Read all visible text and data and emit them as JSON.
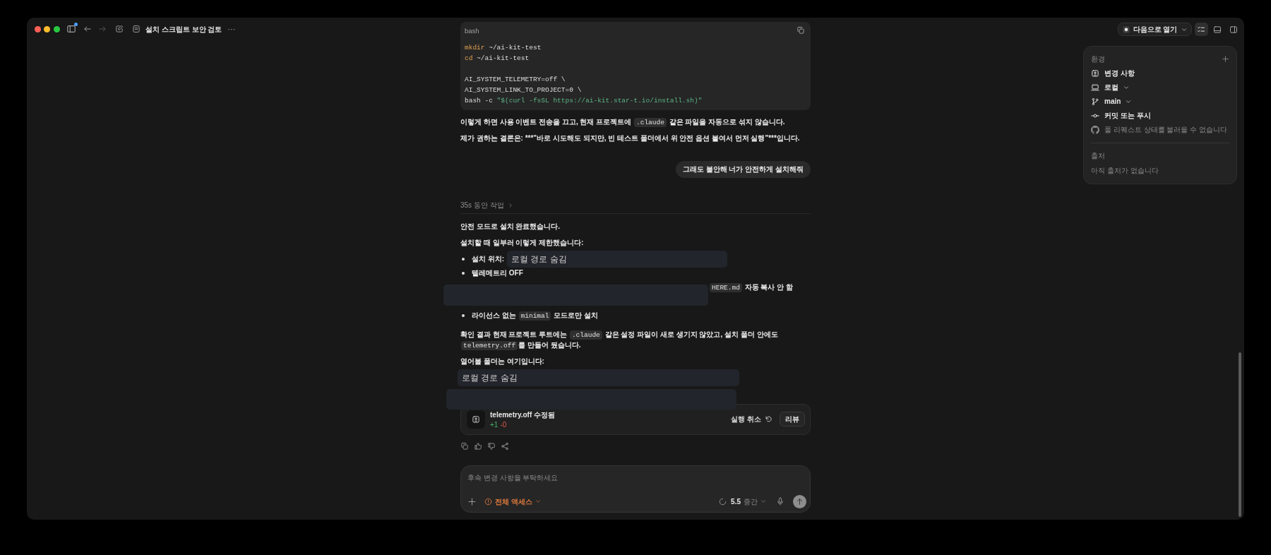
{
  "titlebar": {
    "sidebar_unread": true,
    "nav": [
      {
        "kind": "back",
        "disabled": false
      },
      {
        "kind": "forward",
        "disabled": true
      }
    ],
    "title": "설치 스크립트 보안 검토",
    "more": "···"
  },
  "conversation": [
    {
      "kind": "code_block",
      "language": "bash",
      "tokens": [
        {
          "kind": "keyword",
          "text": "mkdir"
        },
        {
          "kind": "plain",
          "text": " ~/ai-kit-test\n"
        },
        {
          "kind": "keyword",
          "text": "cd"
        },
        {
          "kind": "plain",
          "text": " ~/ai-kit-test\n\nAI_SYSTEM_TELEMETRY=off \\\nAI_SYSTEM_LINK_TO_PROJECT=0 \\\nbash -c "
        },
        {
          "kind": "string",
          "text": "\"$(curl -fsSL https://ai-kit.star-t.io/install.sh)\""
        }
      ]
    },
    {
      "kind": "paragraph",
      "parts": [
        {
          "kind": "text",
          "text": "이렇게 하면 사용 이벤트 전송을 끄고, 현재 프로젝트에 "
        },
        {
          "kind": "code",
          "text": ".claude"
        },
        {
          "kind": "text",
          "text": " 같은 파일을 자동으로 섞지 않습니다."
        }
      ]
    },
    {
      "kind": "paragraph",
      "parts": [
        {
          "kind": "text",
          "text": "제가 권하는 결론은: ***\"바로 시도해도 되지만, 빈 테스트 폴더에서 위 안전 옵션 붙여서 먼저 실행\"***입니다."
        }
      ]
    },
    {
      "kind": "user_message",
      "text": "그래도 불안해 너가 안전하게 설치해줘"
    },
    {
      "kind": "work_summary",
      "text": "35s 동안 작업",
      "expanded": false
    },
    {
      "kind": "paragraph",
      "parts": [
        {
          "kind": "text",
          "text": "안전 모드로 설치 완료했습니다."
        }
      ]
    },
    {
      "kind": "paragraph",
      "parts": [
        {
          "kind": "text",
          "text": "설치할 때 일부러 이렇게 제한했습니다:"
        }
      ]
    },
    {
      "kind": "bullet_list",
      "items": [
        {
          "covered": false,
          "parts": [
            {
              "kind": "text",
              "text": "설치 위치:"
            },
            {
              "kind": "redaction",
              "text": "로컬 경로 숨김"
            }
          ]
        },
        {
          "covered": false,
          "parts": [
            {
              "kind": "text",
              "text": "텔레메트리 OFF"
            }
          ]
        },
        {
          "covered": true,
          "parts": [
            {
              "kind": "code",
              "text": "HERE.md"
            },
            {
              "kind": "text",
              "text": " 자동 복사 안 함"
            }
          ]
        },
        {
          "covered": false,
          "parts": [
            {
              "kind": "text",
              "text": "라이선스 없는 "
            },
            {
              "kind": "code",
              "text": "minimal"
            },
            {
              "kind": "text",
              "text": " 모드로만 설치"
            }
          ]
        }
      ]
    },
    {
      "kind": "paragraph",
      "parts": [
        {
          "kind": "text",
          "text": "확인 결과 현재 프로젝트 루트에는 "
        },
        {
          "kind": "code",
          "text": ".claude"
        },
        {
          "kind": "text",
          "text": " 같은 설정 파일이 새로 생기지 않았고, 설치 폴더 안에도 "
        },
        {
          "kind": "code",
          "text": "telemetry.off"
        },
        {
          "kind": "text",
          "text": "를 만들어 뒀습니다."
        }
      ]
    },
    {
      "kind": "paragraph",
      "parts": [
        {
          "kind": "text",
          "text": "열어볼 폴더는 여기입니다:"
        }
      ]
    },
    {
      "kind": "redaction",
      "text": "로컬 경로 숨김"
    },
    {
      "kind": "redaction_overlay"
    },
    {
      "kind": "file_change",
      "title": "telemetry.off 수정됨",
      "added": "+1",
      "removed": "-0",
      "actions": [
        {
          "kind": "undo",
          "label": "실행 취소"
        },
        {
          "kind": "review",
          "label": "리뷰"
        }
      ]
    },
    {
      "kind": "message_actions"
    }
  ],
  "composer": {
    "placeholder": "후속 변경 사항을 부탁하세요",
    "access": "전체 액세스",
    "model": "5.5",
    "effort": "중간",
    "send_disabled": true
  },
  "toolbar_right": {
    "open_with": "다음으로 열기",
    "toggles": [
      {
        "kind": "checklist",
        "selected": true
      },
      {
        "kind": "terminal",
        "selected": false
      },
      {
        "kind": "sidebar",
        "selected": false
      }
    ]
  },
  "side_panel": {
    "sections": [
      {
        "title": "환경",
        "add_button": true,
        "items": [
          {
            "kind": "changes",
            "label": "변경 사항",
            "dropdown": false,
            "disabled": false
          },
          {
            "kind": "local",
            "label": "로컬",
            "dropdown": true,
            "disabled": false
          },
          {
            "kind": "branch",
            "label": "main",
            "dropdown": true,
            "disabled": false
          },
          {
            "kind": "commit",
            "label": "커밋 또는 푸시",
            "dropdown": false,
            "disabled": false
          },
          {
            "kind": "pull_request",
            "label": "풀 리퀘스트 상태를 불러올 수 없습니다",
            "dropdown": false,
            "disabled": true
          }
        ]
      },
      {
        "title": "출처",
        "add_button": false,
        "empty_text": "아직 출처가 없습니다"
      }
    ]
  }
}
